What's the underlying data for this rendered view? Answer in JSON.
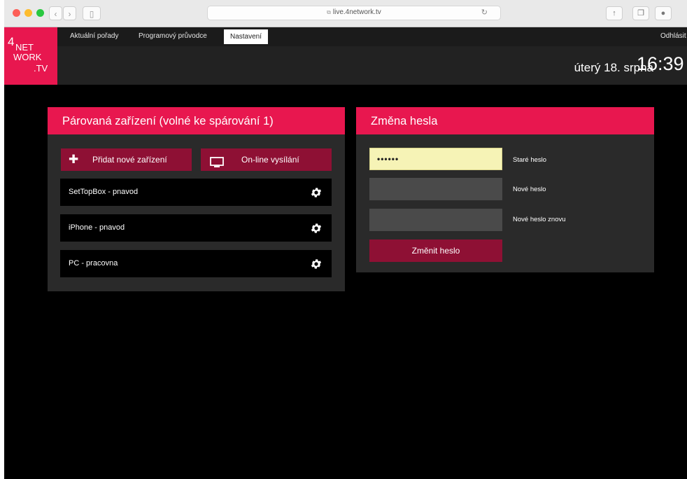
{
  "browser": {
    "url": "live.4network.tv",
    "lock_glyph": "⧉",
    "back_glyph": "‹",
    "forward_glyph": "›",
    "sidebar_glyph": "▯",
    "reload_glyph": "↻",
    "share_glyph": "↑",
    "tabs_glyph": "❐",
    "download_glyph": "●",
    "traffic_colors": [
      "#fc5f57",
      "#fdbc2e",
      "#29c840"
    ]
  },
  "app": {
    "logo_lines": [
      "4",
      "NET",
      "WORK",
      ".TV"
    ],
    "menu": [
      "Aktuální pořady",
      "Programový průvodce",
      "Nastavení"
    ],
    "active_menu": "Nastavení",
    "logout": "Odhlásit",
    "date": "úterý 18. srpna",
    "time": "16:39",
    "accent": "#e8174f",
    "button_color": "#8e1034"
  },
  "devices_panel": {
    "title": "Párovaná zařízení (volné ke spárování 1)",
    "add_label": "Přidat nové zařízení",
    "online_label": "On-line vysílání",
    "add_glyph": "✚",
    "devices": [
      "SetTopBox - pnavod",
      "iPhone - pnavod",
      "PC - pracovna"
    ]
  },
  "password_panel": {
    "title": "Změna hesla",
    "old_value": "••••••",
    "old_label": "Staré heslo",
    "new_label": "Nové heslo",
    "new_again_label": "Nové heslo znovu",
    "submit_label": "Změnit heslo"
  }
}
